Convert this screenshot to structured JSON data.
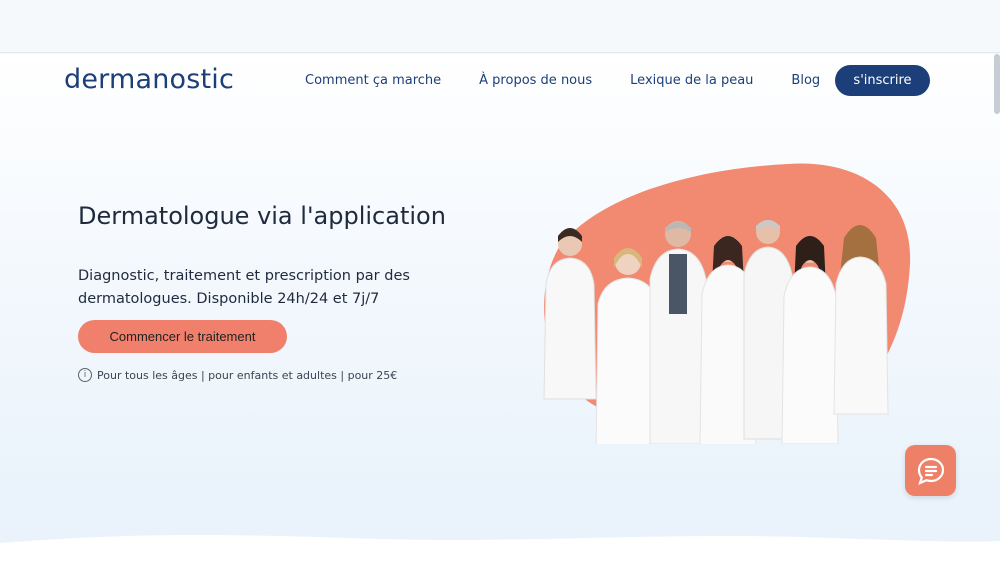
{
  "header": {
    "logo": "dermanostic",
    "nav": [
      {
        "label": "Comment ça marche"
      },
      {
        "label": "À propos de nous"
      },
      {
        "label": "Lexique de la peau"
      },
      {
        "label": "Blog"
      }
    ],
    "signup_label": "s'inscrire"
  },
  "hero": {
    "title": "Dermatologue via l'application",
    "subtitle": "Diagnostic, traitement et prescription par des dermatologues. Disponible 24h/24 et 7j/7",
    "cta_label": "Commencer le traitement",
    "info_text": "Pour tous les âges | pour enfants et adultes | pour 25€"
  },
  "icons": {
    "info": "info-icon",
    "chat": "chat-icon"
  },
  "colors": {
    "brand_navy": "#1c3f7a",
    "accent_coral": "#f07f6c",
    "blob_coral": "#f28a72"
  }
}
